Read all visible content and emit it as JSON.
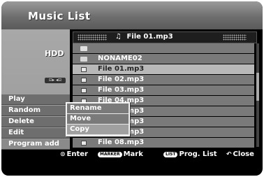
{
  "app": {
    "title": "Music List"
  },
  "source": {
    "label": "HDD",
    "badge": "⊟▸ ◂⊟"
  },
  "left_menu": {
    "items": [
      "Play",
      "Random",
      "Delete",
      "Edit",
      "Program add"
    ]
  },
  "file_header": {
    "current": "File 01.mp3"
  },
  "files": [
    {
      "name": "",
      "type": "up-folder"
    },
    {
      "name": "NONAME02",
      "type": "folder"
    },
    {
      "name": "File 01.mp3",
      "type": "file",
      "selected": true
    },
    {
      "name": "File 02.mp3",
      "type": "file"
    },
    {
      "name": "File 03.mp3",
      "type": "file"
    },
    {
      "name": "File 04.mp3",
      "type": "file"
    },
    {
      "name": "File 05.mp3",
      "type": "file"
    },
    {
      "name": "File 06.mp3",
      "type": "file"
    },
    {
      "name": "File 07.mp3",
      "type": "file"
    },
    {
      "name": "File 08.mp3",
      "type": "file"
    }
  ],
  "edit_submenu": {
    "items": [
      "Rename",
      "Move",
      "Copy"
    ],
    "active": "Copy"
  },
  "hints": {
    "enter": "Enter",
    "marker_key": "MARKER",
    "mark": "Mark",
    "list_key": "LIST",
    "prog_list": "Prog. List",
    "close": "Close"
  }
}
